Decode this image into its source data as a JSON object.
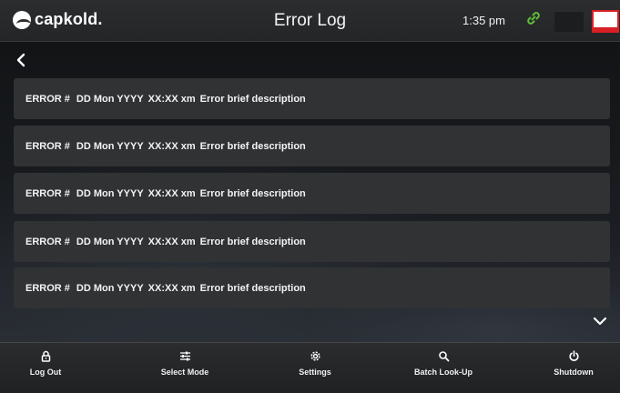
{
  "header": {
    "logo_text": "capkold.",
    "title": "Error Log",
    "time": "1:35 pm",
    "icons": [
      "capkold-logo-icon",
      "link-icon",
      "flag-icon"
    ]
  },
  "colors": {
    "accent_green": "#5fbf3a",
    "flag_red": "#d81f26",
    "row_bg": "#303234"
  },
  "errors": [
    {
      "code": "ERROR #",
      "date": "DD Mon YYYY",
      "time": "XX:XX xm",
      "description": "Error brief description"
    },
    {
      "code": "ERROR #",
      "date": "DD Mon YYYY",
      "time": "XX:XX xm",
      "description": "Error brief description"
    },
    {
      "code": "ERROR #",
      "date": "DD Mon YYYY",
      "time": "XX:XX xm",
      "description": "Error brief description"
    },
    {
      "code": "ERROR #",
      "date": "DD Mon YYYY",
      "time": "XX:XX xm",
      "description": "Error brief description"
    },
    {
      "code": "ERROR #",
      "date": "DD Mon YYYY",
      "time": "XX:XX xm",
      "description": "Error brief description"
    }
  ],
  "nav": [
    {
      "label": "Log Out",
      "icon": "lock-icon"
    },
    {
      "label": "Select Mode",
      "icon": "sliders-icon"
    },
    {
      "label": "Settings",
      "icon": "gear-icon"
    },
    {
      "label": "Batch Look-Up",
      "icon": "search-icon"
    },
    {
      "label": "Shutdown",
      "icon": "power-icon"
    }
  ]
}
